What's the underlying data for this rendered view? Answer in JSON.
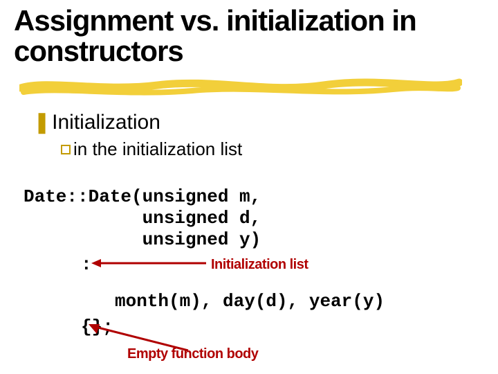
{
  "title": "Assignment vs. initialization in constructors",
  "bullets": {
    "b1": "Initialization",
    "b2": "in the initialization list"
  },
  "code": {
    "l1": "Date::Date(unsigned m,",
    "l2": "           unsigned d,",
    "l3": "           unsigned y)",
    "colon": ":",
    "members": "month(m), day(d), year(y)",
    "brace": "{};"
  },
  "annotations": {
    "init_list": "Initialization list",
    "empty_body": "Empty function body"
  }
}
